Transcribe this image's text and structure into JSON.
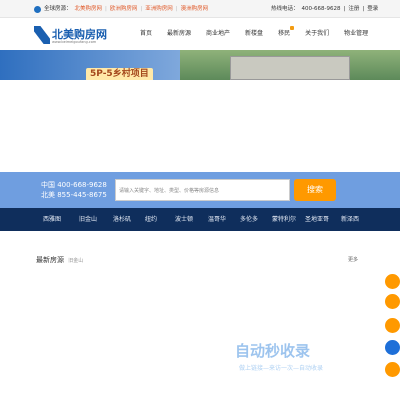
{
  "topbar": {
    "label": "全球房源：",
    "links": [
      "北美购房网",
      "欧洲购房网",
      "亚洲购房网",
      "澳洲购房网"
    ],
    "hotline_label": "热线电话：",
    "hotline": "400-668-9628",
    "register": "注册",
    "login": "登录",
    "divider": "|"
  },
  "logo": {
    "text": "北美购房网",
    "url": "www.beimeigoufang.com"
  },
  "nav": [
    "首页",
    "最新房源",
    "商业地产",
    "新楼盘",
    "移民",
    "关于我们",
    "物业管理"
  ],
  "banner": {
    "title": "5P-5乡村项目"
  },
  "search": {
    "phone_china": "中国 400-668-9628",
    "phone_na": "北美 855-445-8675",
    "placeholder": "请输入关键字、地址、类型、价格等房源信息",
    "button": "搜索"
  },
  "cities": [
    "西雅图",
    "旧金山",
    "洛杉矶",
    "纽约",
    "波士顿",
    "温哥华",
    "多伦多",
    "蒙特利尔",
    "圣地亚哥",
    "新泽西"
  ],
  "section": {
    "title": "最新房源",
    "subtitle": "旧金山",
    "more": "更多"
  },
  "watermark": {
    "title": "自动秒收录",
    "subtitle": "做上链接—来访一次—自动收录"
  },
  "colors": {
    "brand": "#1a5fb0",
    "accent": "#ff9900",
    "city_bar": "#0f2e5c",
    "search_bar": "#6f9ee0"
  }
}
